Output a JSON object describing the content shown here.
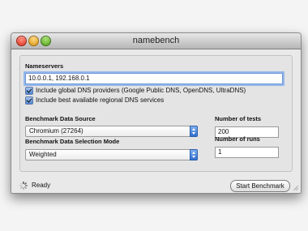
{
  "window": {
    "title": "namebench"
  },
  "nameservers": {
    "heading": "Nameservers",
    "value": "10.0.0.1, 192.168.0.1",
    "include_global": {
      "label": "Include global DNS providers (Google Public DNS, OpenDNS, UltraDNS)",
      "checked": true
    },
    "include_regional": {
      "label": "Include best available regional DNS services",
      "checked": true
    }
  },
  "benchmark": {
    "source_label": "Benchmark Data Source",
    "source_value": "Chromium (27264)",
    "mode_label": "Benchmark Data Selection Mode",
    "mode_value": "Weighted",
    "tests_label": "Number of tests",
    "tests_value": "200",
    "runs_label": "Number of runs",
    "runs_value": "1"
  },
  "status": {
    "text": "Ready"
  },
  "actions": {
    "start_label": "Start Benchmark"
  },
  "colors": {
    "focus_ring": "#94b8eb",
    "select_arrow": "#2f6fcd"
  },
  "icons": [
    "close-icon",
    "minimize-icon",
    "zoom-icon",
    "checkbox-checked-icon",
    "spinner-icon",
    "popup-arrows-icon",
    "resize-grip-icon"
  ]
}
